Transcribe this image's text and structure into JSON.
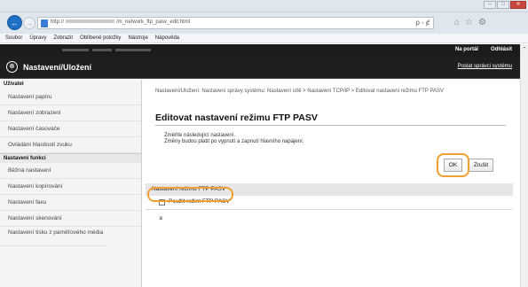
{
  "browser": {
    "url_prefix": "http://",
    "url_suffix": "/m_network_ftp_pasv_edit.html",
    "address_tools": "ρ - ȼ"
  },
  "menu": [
    "Soubor",
    "Úpravy",
    "Zobrazit",
    "Oblíbené položky",
    "Nástroje",
    "Nápověda"
  ],
  "header": {
    "portal_link": "Na portál",
    "logout_link": "Odhlásit",
    "app_title": "Nastavení/Uložení",
    "admin_link": "Poslat správci systému"
  },
  "sidebar": {
    "section1": "Uživatel",
    "items1": [
      "Nastavení papíru",
      "Nastavení zobrazení",
      "Nastavení časovače",
      "Ovládání hlasitosti zvuku"
    ],
    "section2": "Nastavení funkcí",
    "items2": [
      "Běžná nastavení",
      "Nastavení kopírování",
      "Nastavení faxu",
      "Nastavení skenování",
      "Nastavení tisku z paměťového média"
    ]
  },
  "main": {
    "breadcrumb": "Nastavení/Uložení: Nastavení správy systému: Nastavení sítě > Nastavení TCP/IP > Editovat nastavení režimu FTP PASV",
    "title": "Editovat nastavení režimu FTP PASV",
    "note1": "Změňte následující nastavení.",
    "note2": "Změny budou platit po vypnutí a zapnutí hlavního napájení.",
    "ok_label": "OK",
    "cancel_label": "Zrušit",
    "section_label": "Nastavení režimu FTP PASV",
    "checkbox_label": "Použít režim FTP PASV",
    "checkbox_checked": false,
    "to_top": "⌅"
  },
  "colors": {
    "highlight": "#f0a030",
    "header_bg": "#1f1f1f",
    "sidebar_bg": "#f4f4f4"
  }
}
